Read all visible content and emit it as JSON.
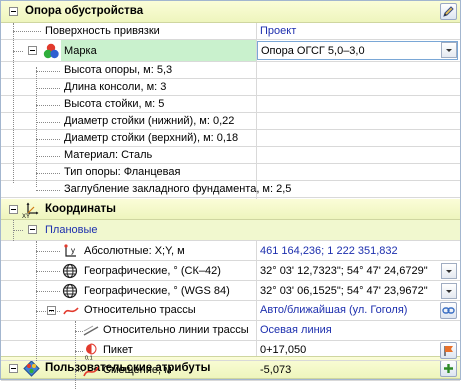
{
  "section_support": {
    "title": "Опора обустройства",
    "props": {
      "binding_surface": {
        "label": "Поверхность привязки",
        "value": "Проект"
      },
      "mark": {
        "label": "Марка",
        "value": "Опора ОГСГ 5,0–3,0"
      },
      "height": "Высота опоры, м: 5,3",
      "console_length": "Длина консоли, м: 3",
      "rack_height": "Высота стойки, м: 5",
      "diameter_bottom": "Диаметр стойки (нижний), м: 0,22",
      "diameter_top": "Диаметр стойки (верхний), м: 0,18",
      "material": "Материал: Сталь",
      "support_type": "Тип опоры: Фланцевая",
      "foundation_depth": "Заглубление закладного фундамента, м: 2,5"
    }
  },
  "section_coords": {
    "title": "Координаты",
    "planar": "Плановые",
    "absolute": {
      "label": "Абсолютные: X;Y, м",
      "value": "461 164,236; 1 222 351,832",
      "icon_text": "y"
    },
    "geo_sk42": {
      "label": "Географические, ° (СК–42)",
      "value": "32° 03' 12,7323\"; 54° 47' 24,6729\""
    },
    "geo_wgs84": {
      "label": "Географические, ° (WGS 84)",
      "value": "32° 03' 06,1525\"; 54° 47' 23,9672\""
    },
    "relative_route": {
      "label": "Относительно трассы",
      "value": "Авто/ближайшая (ул. Гоголя)"
    },
    "relative_line": {
      "label": "Относительно линии трассы",
      "value": "Осевая линия"
    },
    "picket": {
      "label": "Пикет",
      "value": "0+17,050",
      "icon_text": "0,1"
    },
    "offset": {
      "label": "Смещение, м",
      "value": "-5,073"
    }
  },
  "section_user": {
    "title": "Пользовательские атрибуты"
  },
  "colors": {
    "category_bg": "#f1f6c8",
    "selected_row": "#c9f1cd",
    "value_blue": "#1d2fae",
    "grid_border": "#a3b6cf"
  }
}
